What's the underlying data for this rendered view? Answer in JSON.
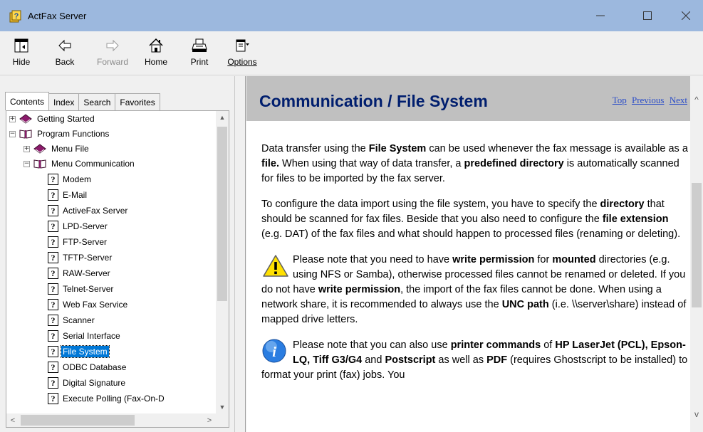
{
  "window": {
    "title": "ActFax Server",
    "minimize_glyph": "—",
    "maximize_glyph": "☐",
    "close_glyph": "✕"
  },
  "toolbar": {
    "hide": "Hide",
    "back": "Back",
    "forward": "Forward",
    "home": "Home",
    "print": "Print",
    "options": "Options"
  },
  "tabs": {
    "contents": "Contents",
    "index": "Index",
    "search": "Search",
    "favorites": "Favorites"
  },
  "tree": {
    "getting_started": "Getting Started",
    "program_functions": "Program Functions",
    "menu_file": "Menu File",
    "menu_communication": "Menu Communication",
    "items": [
      "Modem",
      "E-Mail",
      "ActiveFax Server",
      "LPD-Server",
      "FTP-Server",
      "TFTP-Server",
      "RAW-Server",
      "Telnet-Server",
      "Web Fax Service",
      "Scanner",
      "Serial Interface",
      "File System",
      "ODBC Database",
      "Digital Signature",
      "Execute Polling (Fax-On-D"
    ],
    "selected": "File System",
    "expand_glyph": "+",
    "collapse_glyph": "−",
    "q_glyph": "?"
  },
  "content": {
    "heading": "Communication / File System",
    "nav": {
      "top": "Top",
      "previous": "Previous",
      "next": "Next"
    },
    "p1": {
      "a": "Data transfer using the ",
      "b": "File System",
      "c": " can be used whenever the fax message is available as a ",
      "d": "file.",
      "e": " When using that way of data transfer, a ",
      "f": "predefined directory",
      "g": " is automatically scanned for files to be imported by the fax server."
    },
    "p2": {
      "a": "To configure the data import using the file system, you have to specify the ",
      "b": "directory",
      "c": " that should be scanned for fax files. Beside that you also need to configure the ",
      "d": "file extension",
      "e": " (e.g. DAT) of the fax files and what should happen to processed files (renaming or deleting)."
    },
    "p3": {
      "a": "Please note that you need to have ",
      "b": "write permission",
      "c": " for ",
      "d": "mounted",
      "e": " directories (e.g. using NFS or Samba), otherwise processed files cannot be renamed or deleted. If you do not have ",
      "f": "write permission",
      "g": ", the import of the fax files cannot be done. When using a network share, it is recommended to always use the ",
      "h": "UNC path",
      "i": " (i.e. \\\\server\\share) instead of mapped drive letters."
    },
    "p4": {
      "a": "Please note that you can also use ",
      "b": "printer commands",
      "c": " of ",
      "d": "HP LaserJet (PCL), Epson-LQ, Tiff G3/G4",
      "e": " and ",
      "f": "Postscript",
      "g": " as well as ",
      "h": "PDF",
      "i": " (requires Ghostscript to be installed) to format your print (fax) jobs. You"
    }
  },
  "scroll": {
    "up": "▲",
    "down": "▼",
    "left": "<",
    "right": ">",
    "up_chevron": "^",
    "down_chevron": "v"
  },
  "colors": {
    "titlebar": "#9cb8de",
    "heading_bg": "#c0c0c0",
    "heading_text": "#001e6e",
    "link": "#2b4dc8",
    "selection": "#0078d7"
  }
}
